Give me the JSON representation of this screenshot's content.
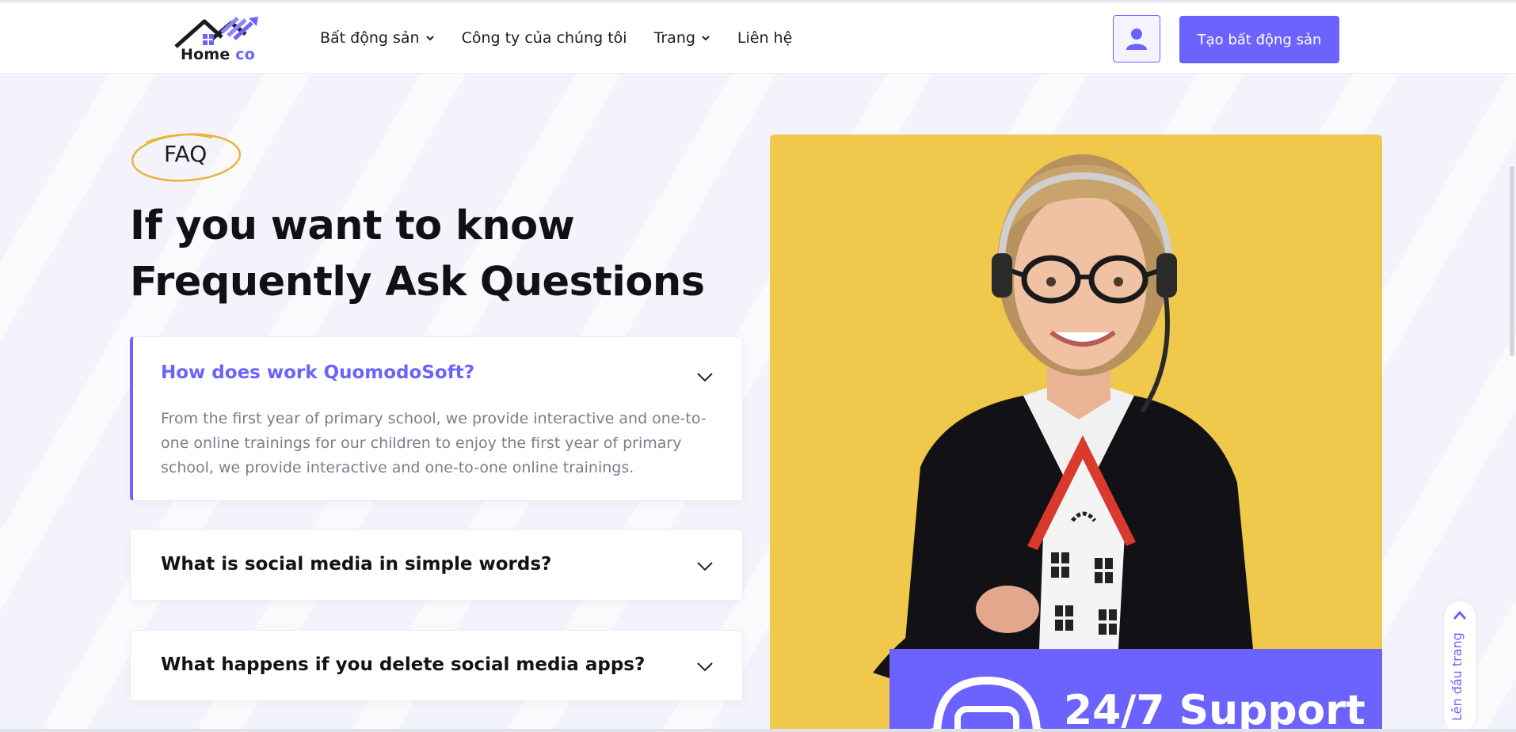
{
  "header": {
    "logo_text_main": "Home",
    "logo_text_accent": "co",
    "nav": [
      {
        "label": "Bất động sản",
        "has_dropdown": true
      },
      {
        "label": "Công ty của chúng tôi",
        "has_dropdown": false
      },
      {
        "label": "Trang",
        "has_dropdown": true
      },
      {
        "label": "Liên hệ",
        "has_dropdown": false
      }
    ],
    "user_icon": "user-icon",
    "create_button_label": "Tạo bất động sản"
  },
  "faq": {
    "badge": "FAQ",
    "heading_line1": "If you want to know",
    "heading_line2": "Frequently Ask Questions",
    "items": [
      {
        "question": "How does work QuomodoSoft?",
        "answer": "From the first year of primary school, we provide interactive and one-to-one online trainings for our children to enjoy the first year of primary school, we provide interactive and one-to-one online trainings.",
        "open": true
      },
      {
        "question": "What is social media in simple words?",
        "open": false
      },
      {
        "question": "What happens if you delete social media apps?",
        "open": false
      }
    ]
  },
  "support": {
    "title": "24/7 Support",
    "icon": "headset-chat-icon"
  },
  "back_to_top": {
    "label": "Lên đầu trang",
    "icon": "chevron-up-icon"
  },
  "colors": {
    "accent": "#6c63ff",
    "panel_yellow": "#f0c84b",
    "badge_ring": "#e8b53a"
  }
}
